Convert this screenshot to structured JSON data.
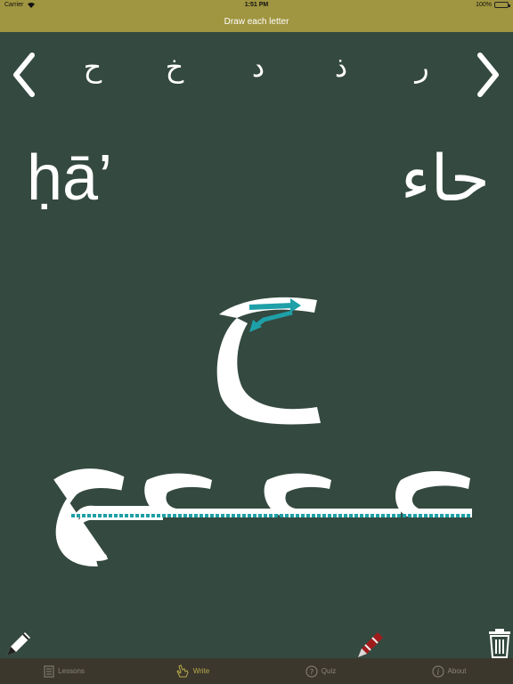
{
  "status_bar": {
    "carrier": "Carrier",
    "time": "1:51 PM",
    "battery_percent": "100%"
  },
  "nav": {
    "title": "Draw each letter"
  },
  "letter_strip": {
    "letters": [
      "ح",
      "خ",
      "د",
      "ذ",
      "ر"
    ]
  },
  "current_letter": {
    "transliteration": "ḥā’",
    "name": "حاء",
    "glyph": "ح",
    "forms": "حـحـح"
  },
  "tabs": [
    {
      "label": "Lessons",
      "icon": "book-icon"
    },
    {
      "label": "Write",
      "icon": "hand-icon"
    },
    {
      "label": "Quiz",
      "icon": "question-icon"
    },
    {
      "label": "About",
      "icon": "info-icon"
    }
  ],
  "active_tab": "Write",
  "colors": {
    "background": "#34493f",
    "header": "#a09540",
    "tab_bar": "#3c372c",
    "active_tab": "#b7a94c",
    "guide": "#1ea0a8"
  }
}
